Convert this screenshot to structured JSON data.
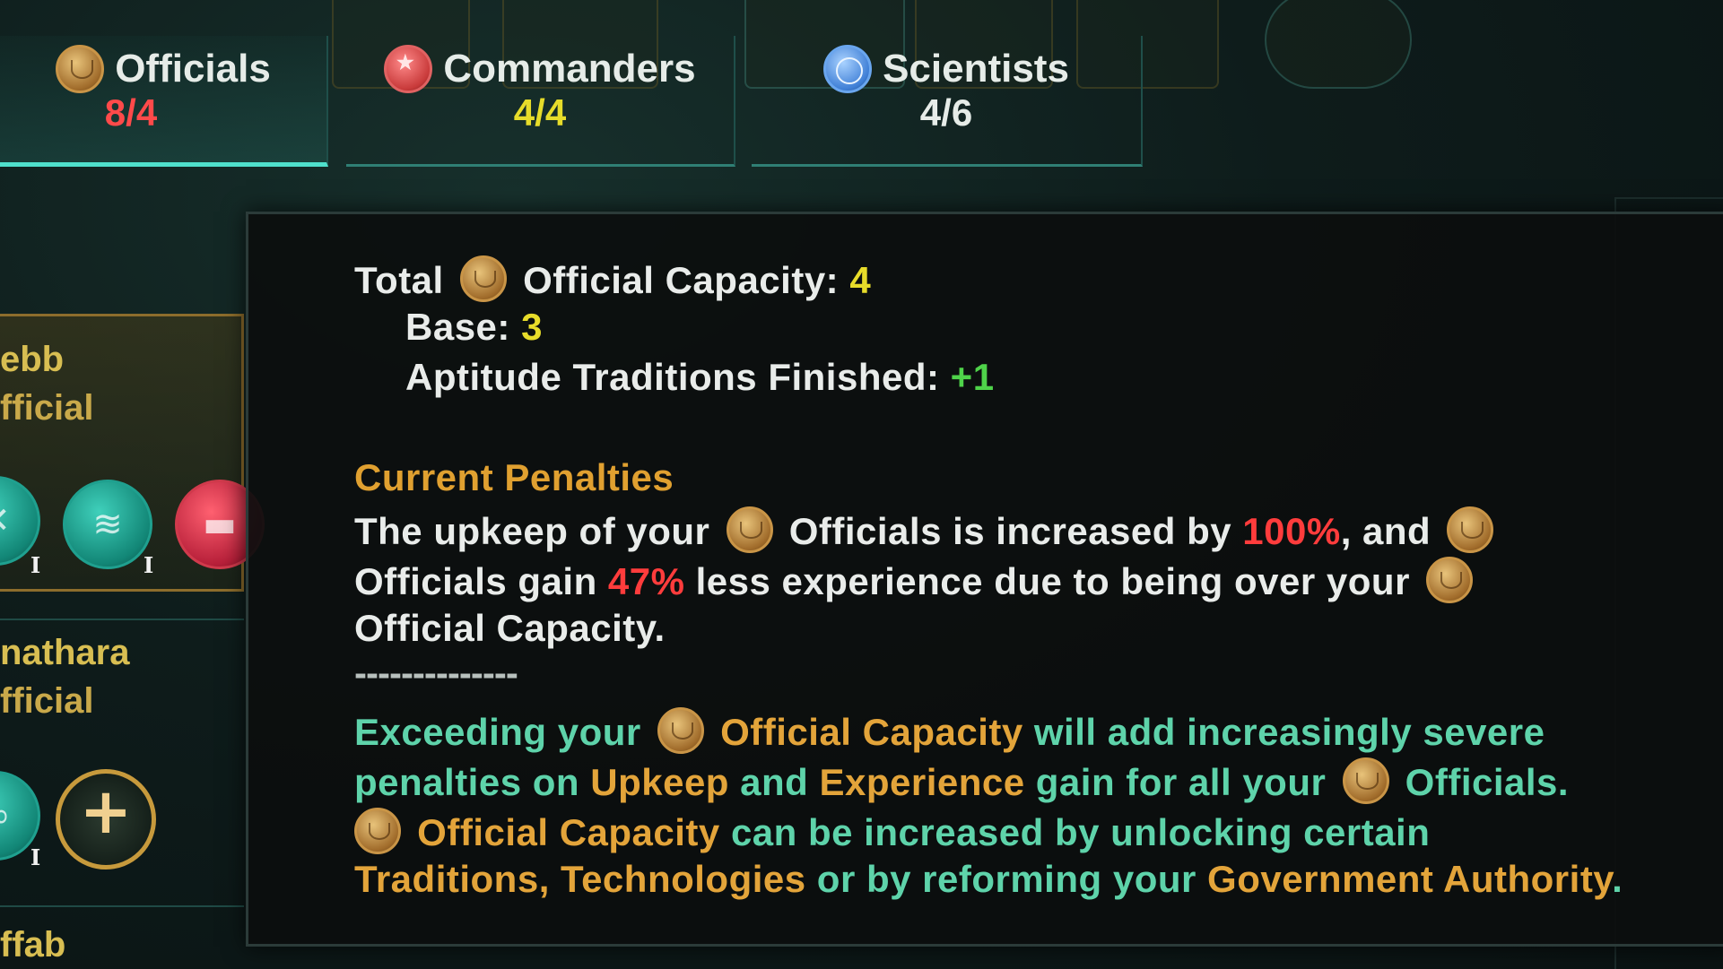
{
  "tabs": [
    {
      "label": "Officials",
      "count": "8/4",
      "count_color": "#ff4a4a",
      "icon": "officials-coin-icon"
    },
    {
      "label": "Commanders",
      "count": "4/4",
      "count_color": "#e7dc2a",
      "icon": "commanders-star-icon"
    },
    {
      "label": "Scientists",
      "count": "4/6",
      "count_color": "#e6ece8",
      "icon": "scientists-orb-icon"
    }
  ],
  "leaders": [
    {
      "name": "ebb",
      "role": "fficial"
    },
    {
      "name": "nathara",
      "role": "fficial"
    },
    {
      "name": "ffab"
    }
  ],
  "trait_levels": [
    "I",
    "I",
    "I"
  ],
  "add_trait_glyph": "+",
  "tooltip": {
    "total_label": "Total",
    "capacity_label": "Official Capacity:",
    "capacity_value": "4",
    "base_label": "Base:",
    "base_value": "3",
    "aptitude_label": "Aptitude Traditions Finished:",
    "aptitude_value": "+1",
    "penalties_title": "Current Penalties",
    "p1_a": "The upkeep of your",
    "p1_b": "Officials is increased by",
    "p1_pct": "100%",
    "p1_c": ", and",
    "p2_a": "Officials gain",
    "p2_pct": "47%",
    "p2_b": "less experience due to being over your",
    "p3": "Official Capacity.",
    "divider": "--------------",
    "e1_a": "Exceeding your",
    "e1_b": "Official Capacity",
    "e1_c": "will add increasingly severe",
    "e2_a": "penalties on",
    "e2_b": "Upkeep",
    "e2_c": "and",
    "e2_d": "Experience",
    "e2_e": "gain for all your",
    "e2_f": "Officials.",
    "e3_a": "Official Capacity",
    "e3_b": "can be increased by unlocking certain",
    "e4_a": "Traditions, Technologies",
    "e4_b": "or by reforming your",
    "e4_c": "Government Authority",
    "e4_d": "."
  }
}
